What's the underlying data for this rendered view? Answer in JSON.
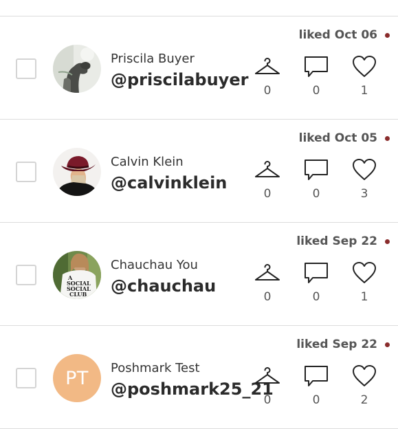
{
  "colors": {
    "unread_dot": "#8a2c2c",
    "divider": "#dcdcdc",
    "initials_bg": "#f2b985"
  },
  "icons": {
    "closet": "hanger-icon",
    "comments": "speech-bubble-icon",
    "likes": "heart-icon"
  },
  "rows": [
    {
      "liked": "liked Oct 06",
      "name": "Priscila Buyer",
      "handle": "@priscilabuyer",
      "closet_count": "0",
      "comment_count": "0",
      "like_count": "1",
      "avatar_type": "photo"
    },
    {
      "liked": "liked Oct 05",
      "name": "Calvin Klein",
      "handle": "@calvinklein",
      "closet_count": "0",
      "comment_count": "0",
      "like_count": "3",
      "avatar_type": "photo"
    },
    {
      "liked": "liked Sep 22",
      "name": "Chauchau You",
      "handle": "@chauchau",
      "closet_count": "0",
      "comment_count": "0",
      "like_count": "1",
      "avatar_type": "photo",
      "avatar_shirt_text": [
        "A",
        "SOCIAL",
        "SOCIAL",
        "CLUB"
      ]
    },
    {
      "liked": "liked Sep 22",
      "name": "Poshmark Test",
      "handle": "@poshmark25_21",
      "closet_count": "0",
      "comment_count": "0",
      "like_count": "2",
      "avatar_type": "initials",
      "avatar_initials": "PT"
    }
  ]
}
